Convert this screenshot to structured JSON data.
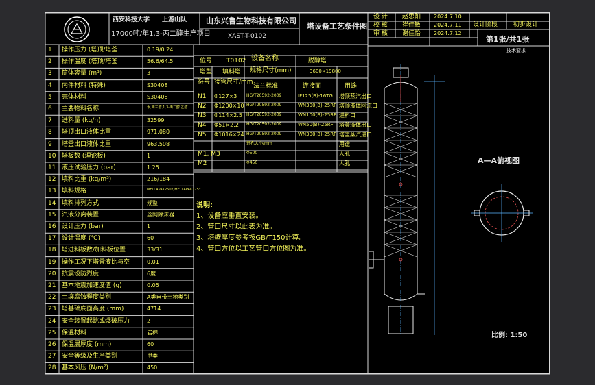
{
  "header": {
    "school": "西安科技大学",
    "team": "上游山队",
    "project": "17000吨/年1,3-丙二醇生产项目",
    "company": "山东兴鲁生物科技有限公司",
    "drawing_no": "XAST-T-0102",
    "drawing_title": "塔设备工艺条件图",
    "roles": [
      {
        "role": "设  计",
        "name": "赵思阳",
        "date": "2024.7.10"
      },
      {
        "role": "校  核",
        "name": "崔佳敏",
        "date": "2024.7.11"
      },
      {
        "role": "审  核",
        "name": "谢佳怡",
        "date": "2024.7.12"
      }
    ],
    "stage_label": "设计阶段",
    "stage_value": "初步设计",
    "sheet": "第1张/共1张",
    "tech_req_title": "技术要求"
  },
  "spec_rows": [
    {
      "no": "1",
      "name": "操作压力 (塔顶/塔釜",
      "value": "0.19/0.24"
    },
    {
      "no": "2",
      "name": "操作温度 (塔顶/塔釜",
      "value": "56.6/64.5"
    },
    {
      "no": "3",
      "name": "筒体容量 (m³)",
      "value": "3"
    },
    {
      "no": "4",
      "name": "内件材料 (特殊)",
      "value": "S30408"
    },
    {
      "no": "5",
      "name": "壳体材料",
      "value": "S30408"
    },
    {
      "no": "6",
      "name": "主要物料名称",
      "value": "水,丙三醇,1,3-丙二醇,乙醇"
    },
    {
      "no": "7",
      "name": "进料量 (kg/h)",
      "value": "32599"
    },
    {
      "no": "8",
      "name": "塔顶出口液体比重",
      "value": "971.080"
    },
    {
      "no": "9",
      "name": "塔釜出口液体比重",
      "value": "963.508"
    },
    {
      "no": "10",
      "name": "塔板数 (理论板)",
      "value": "1"
    },
    {
      "no": "11",
      "name": "液压试验压力 (bar)",
      "value": "1.25"
    },
    {
      "no": "12",
      "name": "填料比重 (kg/m³)",
      "value": "216/184"
    },
    {
      "no": "13",
      "name": "填料规格",
      "value": "MELLAPAK250Y/MELLAPAK125Y"
    },
    {
      "no": "14",
      "name": "填料排列方式",
      "value": "规整"
    },
    {
      "no": "15",
      "name": "汽液分离装置",
      "value": "丝网除沫器"
    },
    {
      "no": "16",
      "name": "设计压力 (bar)",
      "value": "1"
    },
    {
      "no": "17",
      "name": "设计温度 (℃)",
      "value": "60"
    },
    {
      "no": "18",
      "name": "塔进料板数/加料板位置",
      "value": "33/31"
    },
    {
      "no": "19",
      "name": "操作工况下塔釜液比与空",
      "value": "0.01"
    },
    {
      "no": "20",
      "name": "抗震设防烈度",
      "value": "6度"
    },
    {
      "no": "21",
      "name": "基本地震加速度值 (g)",
      "value": "0.05"
    },
    {
      "no": "22",
      "name": "土壤腐蚀程度类别",
      "value": "A类自带土地类别"
    },
    {
      "no": "23",
      "name": "塔基础底面高度 (mm)",
      "value": "4714"
    },
    {
      "no": "24",
      "name": "安全装置起跳或爆破压力",
      "value": "2"
    },
    {
      "no": "25",
      "name": "保温材料",
      "value": "岩棉"
    },
    {
      "no": "26",
      "name": "保温层厚度 (mm)",
      "value": "60"
    },
    {
      "no": "27",
      "name": "安全等级及生产类别",
      "value": "甲类"
    },
    {
      "no": "28",
      "name": "基本风压 (N/m²)",
      "value": "450"
    }
  ],
  "equipment": {
    "tag_label": "位号",
    "tag": "T0102",
    "name_label": "设备名称",
    "name": "脱醇塔",
    "type_label": "塔型",
    "type": "填料塔",
    "size_label": "规格尺寸(mm)",
    "size": "3600×19800"
  },
  "nozzle_headers": [
    "符号",
    "接管尺寸/mm",
    "法兰标准",
    "连接面",
    "用途"
  ],
  "nozzles": [
    {
      "sym": "N1",
      "size": "Φ127×3",
      "std": "HG/T20592-2009",
      "face": "IF125(B)-16TG",
      "use": "塔顶蒸汽出口"
    },
    {
      "sym": "N2",
      "size": "Φ1200×10",
      "std": "HG/T20592-2009",
      "face": "WN300(B)-25RF",
      "use": "塔顶液体回流口"
    },
    {
      "sym": "N3",
      "size": "Φ114×2.5",
      "std": "HG/T20592-2009",
      "face": "WN100(B)-25RF",
      "use": "进料口"
    },
    {
      "sym": "N4",
      "size": "Φ51×2.2",
      "std": "HG/T20592-2009",
      "face": "WN50(B)-25RF",
      "use": "塔釜液体出口"
    },
    {
      "sym": "N5",
      "size": "Φ1016×24",
      "std": "HG/T20592-2009",
      "face": "WN300(B)-25RF",
      "use": "塔釜蒸汽进口"
    },
    {
      "sym": "",
      "size": "",
      "std": "开孔大小/mm",
      "face": "",
      "use": "用途"
    },
    {
      "sym": "M1, M3",
      "size": "",
      "std": "Φ500",
      "face": "",
      "use": "人孔"
    },
    {
      "sym": "M2",
      "size": "",
      "std": "Φ450",
      "face": "",
      "use": "人孔"
    }
  ],
  "notes": {
    "title": "说明:",
    "lines": [
      "1、设备应垂直安装。",
      "2、管口尺寸以此表为准。",
      "3、塔壁厚度参考按GB/T150计算。",
      "4、管口方位以工艺管口方位图为准。"
    ]
  },
  "section_label": "A—A俯视图",
  "scale": "比例: 1:50"
}
